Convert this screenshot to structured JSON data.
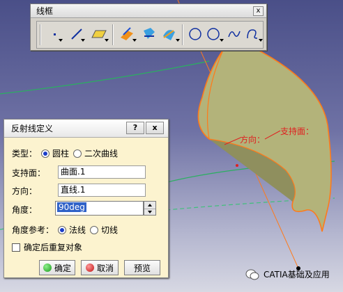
{
  "toolbar": {
    "title": "线框",
    "close": "x"
  },
  "dialog": {
    "title": "反射线定义",
    "help": "?",
    "close": "x",
    "type_label": "类型：",
    "type_cylinder": "圆柱",
    "type_conic": "二次曲线",
    "support_label": "支持面：",
    "support_value": "曲面.1",
    "direction_label": "方向：",
    "direction_value": "直线.1",
    "angle_label": "角度：",
    "angle_value": "90deg",
    "angle_ref_label": "角度参考：",
    "angle_ref_normal": "法线",
    "angle_ref_tangent": "切线",
    "repeat_label": "确定后重复对象",
    "ok": "确定",
    "cancel": "取消",
    "preview": "预览"
  },
  "scene": {
    "label_direction": "方向：",
    "label_support": "支持面："
  },
  "watermark": {
    "text": "CATIA基础及应用"
  }
}
